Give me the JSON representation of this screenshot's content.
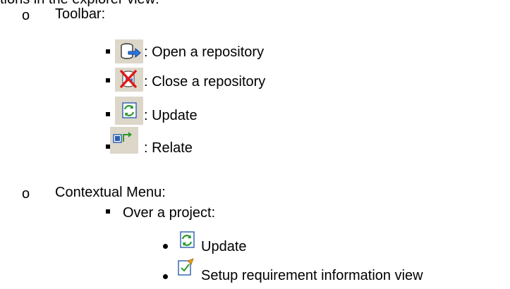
{
  "header_fragment": "tions in the explorer view:",
  "sections": [
    {
      "bullet": "o",
      "label": "Toolbar:",
      "items": [
        {
          "icon": "open-repository-icon",
          "label": ": Open a repository"
        },
        {
          "icon": "close-repository-icon",
          "label": ": Close a repository"
        },
        {
          "icon": "update-icon",
          "label": ": Update"
        },
        {
          "icon": "relate-icon",
          "label": ": Relate"
        }
      ]
    },
    {
      "bullet": "o",
      "label": "Contextual Menu:",
      "subsection": {
        "label": "Over a project:",
        "items": [
          {
            "icon": "update-icon",
            "label": "Update"
          },
          {
            "icon": "setup-view-icon",
            "label": "Setup requirement information view"
          }
        ]
      }
    }
  ]
}
